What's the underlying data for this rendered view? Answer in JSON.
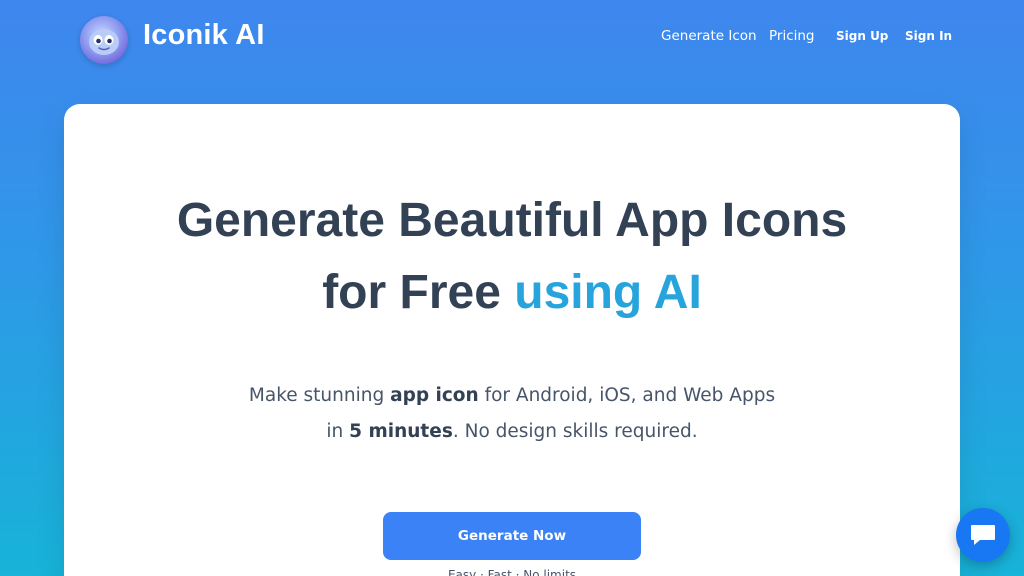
{
  "nav": {
    "brand": "Iconik AI",
    "links": [
      "Generate Icon",
      "Pricing"
    ],
    "sign_up": "Sign Up",
    "sign_in": "Sign In"
  },
  "hero": {
    "line1": "Generate Beautiful App Icons",
    "line2_plain": "for Free",
    "line2_accent": "using AI",
    "sub1_a": "Make stunning",
    "sub1_bold": "app icon",
    "sub1_b": "for Android, iOS, and Web Apps",
    "sub2_a": "in",
    "sub2_bold": "5 minutes",
    "sub2_b": ". No design skills required.",
    "cta": "Generate Now",
    "cta_note": "Easy · Fast · No limits"
  },
  "icons": {
    "logo": "robot-mascot-icon",
    "chat": "chat-bubble-icon"
  },
  "colors": {
    "accent": "#28a4dd",
    "button": "#3b82f6",
    "chat": "#1877f2"
  }
}
